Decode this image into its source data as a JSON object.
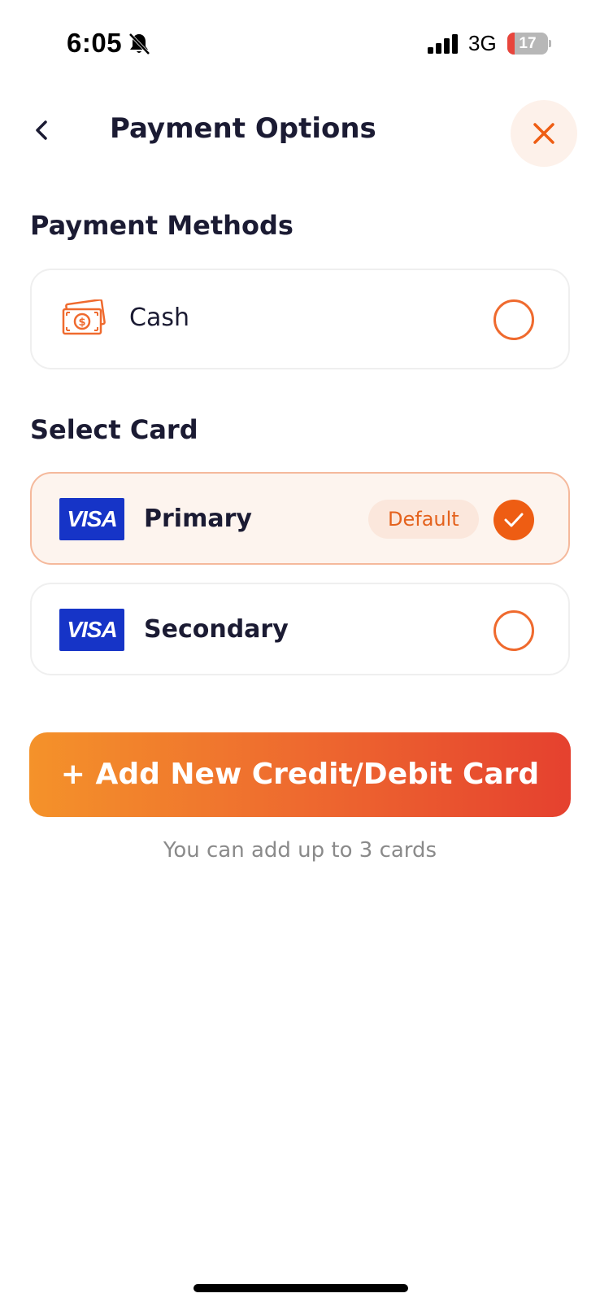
{
  "status_bar": {
    "time": "6:05",
    "network": "3G",
    "battery_level": "17",
    "battery_fraction": 0.17
  },
  "header": {
    "title": "Payment Options",
    "back_icon": "chevron-left-icon",
    "close_icon": "close-icon"
  },
  "payment_methods": {
    "title": "Payment Methods",
    "items": [
      {
        "label": "Cash",
        "icon": "cash-icon",
        "selected": false
      }
    ]
  },
  "select_card": {
    "title": "Select Card",
    "cards": [
      {
        "brand": "VISA",
        "label": "Primary",
        "badge": "Default",
        "selected": true
      },
      {
        "brand": "VISA",
        "label": "Secondary",
        "selected": false
      }
    ]
  },
  "add_card_button": {
    "label": "+ Add New Credit/Debit Card"
  },
  "helper_text": "You can add up to 3 cards",
  "colors": {
    "accent": "#EE5D13",
    "gradient_start": "#F4922A",
    "gradient_end": "#E5412F",
    "visa_blue": "#1634C7",
    "title_text": "#1B1B33"
  }
}
